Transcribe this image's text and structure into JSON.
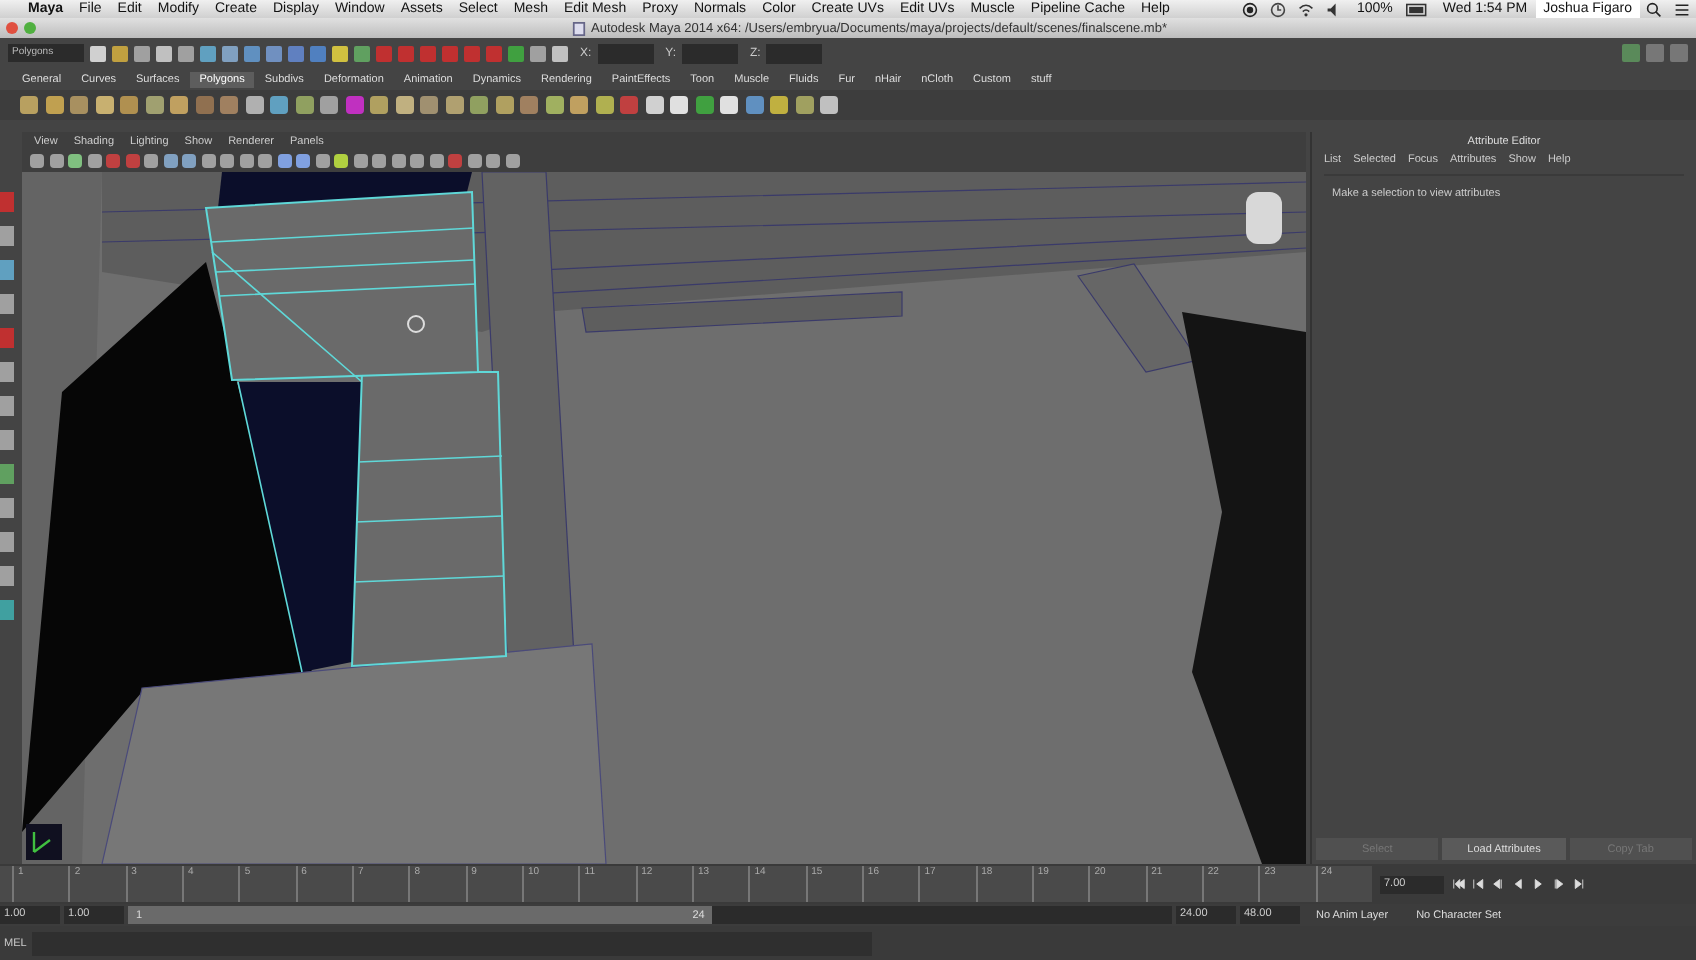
{
  "menubar": {
    "app": "Maya",
    "items": [
      "File",
      "Edit",
      "Modify",
      "Create",
      "Display",
      "Window",
      "Assets",
      "Select",
      "Mesh",
      "Edit Mesh",
      "Proxy",
      "Normals",
      "Color",
      "Create UVs",
      "Edit UVs",
      "Muscle",
      "Pipeline Cache",
      "Help"
    ],
    "battery": "100%",
    "clock": "Wed 1:54 PM",
    "user": "Joshua Figaro"
  },
  "window": {
    "title": "Autodesk Maya 2014 x64: /Users/embryua/Documents/maya/projects/default/scenes/finalscene.mb*"
  },
  "status_line": {
    "mode": "Polygons",
    "fields": [
      {
        "label": "X:"
      },
      {
        "label": "Y:"
      },
      {
        "label": "Z:"
      }
    ]
  },
  "shelf": {
    "tabs": [
      {
        "label": "General",
        "selected": false
      },
      {
        "label": "Curves",
        "selected": false
      },
      {
        "label": "Surfaces",
        "selected": false
      },
      {
        "label": "Polygons",
        "selected": true
      },
      {
        "label": "Subdivs",
        "selected": false
      },
      {
        "label": "Deformation",
        "selected": false
      },
      {
        "label": "Animation",
        "selected": false
      },
      {
        "label": "Dynamics",
        "selected": false
      },
      {
        "label": "Rendering",
        "selected": false
      },
      {
        "label": "PaintEffects",
        "selected": false
      },
      {
        "label": "Toon",
        "selected": false
      },
      {
        "label": "Muscle",
        "selected": false
      },
      {
        "label": "Fluids",
        "selected": false
      },
      {
        "label": "Fur",
        "selected": false
      },
      {
        "label": "nHair",
        "selected": false
      },
      {
        "label": "nCloth",
        "selected": false
      },
      {
        "label": "Custom",
        "selected": false
      },
      {
        "label": "stuff",
        "selected": false
      }
    ]
  },
  "viewport": {
    "menu": [
      "View",
      "Shading",
      "Lighting",
      "Show",
      "Renderer",
      "Panels"
    ]
  },
  "attribute_editor": {
    "title": "Attribute Editor",
    "menu": [
      "List",
      "Selected",
      "Focus",
      "Attributes",
      "Show",
      "Help"
    ],
    "message": "Make a selection to view attributes",
    "buttons": [
      {
        "label": "Select",
        "disabled": true
      },
      {
        "label": "Load Attributes",
        "disabled": false
      },
      {
        "label": "Copy Tab",
        "disabled": true
      }
    ]
  },
  "time_slider": {
    "ticks": [
      "1",
      "2",
      "3",
      "4",
      "5",
      "6",
      "7",
      "8",
      "9",
      "10",
      "11",
      "12",
      "13",
      "14",
      "15",
      "16",
      "17",
      "18",
      "19",
      "20",
      "21",
      "22",
      "23",
      "24"
    ],
    "current_time": "7.00"
  },
  "range_slider": {
    "start": "1.00",
    "playback_start": "1.00",
    "level": 0.56,
    "range_start": "1",
    "range_end": "24",
    "playback_end": "24.00",
    "end": "48.00",
    "anim_layer": "No Anim Layer",
    "character_set": "No Character Set"
  },
  "command_line": {
    "language": "MEL"
  }
}
